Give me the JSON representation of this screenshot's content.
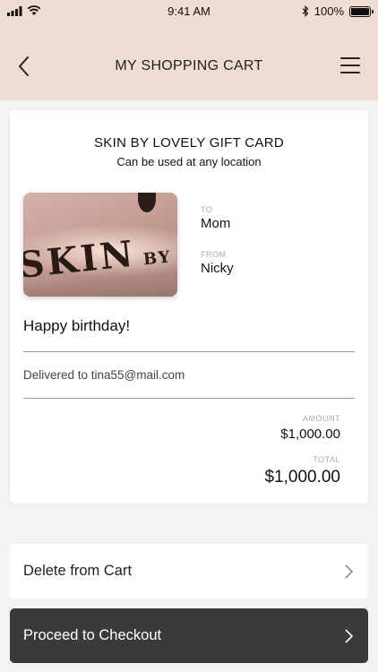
{
  "status_bar": {
    "time": "9:41 AM",
    "battery": "100%",
    "icons": [
      "signal-icon",
      "wifi-icon",
      "bluetooth-icon",
      "battery-icon"
    ]
  },
  "header": {
    "title": "MY SHOPPING CART",
    "back_icon": "chevron-left-icon",
    "menu_icon": "hamburger-menu-icon",
    "background": "#efdcd2"
  },
  "gift_card": {
    "title": "SKIN BY LOVELY GIFT CARD",
    "subtitle": "Can be used at any location",
    "image_sign_text": "SKIN BY LOVELY",
    "to_label": "TO",
    "to_value": "Mom",
    "from_label": "FROM",
    "from_value": "Nicky",
    "message": "Happy birthday!",
    "delivered": "Delivered to tina55@mail.com",
    "amount_label": "AMOUNT",
    "amount_value": "$1,000.00",
    "total_label": "TOTAL",
    "total_value": "$1,000.00"
  },
  "actions": {
    "delete_label": "Delete from Cart",
    "checkout_label": "Proceed to Checkout",
    "checkout_color": "#3a3a3c"
  }
}
